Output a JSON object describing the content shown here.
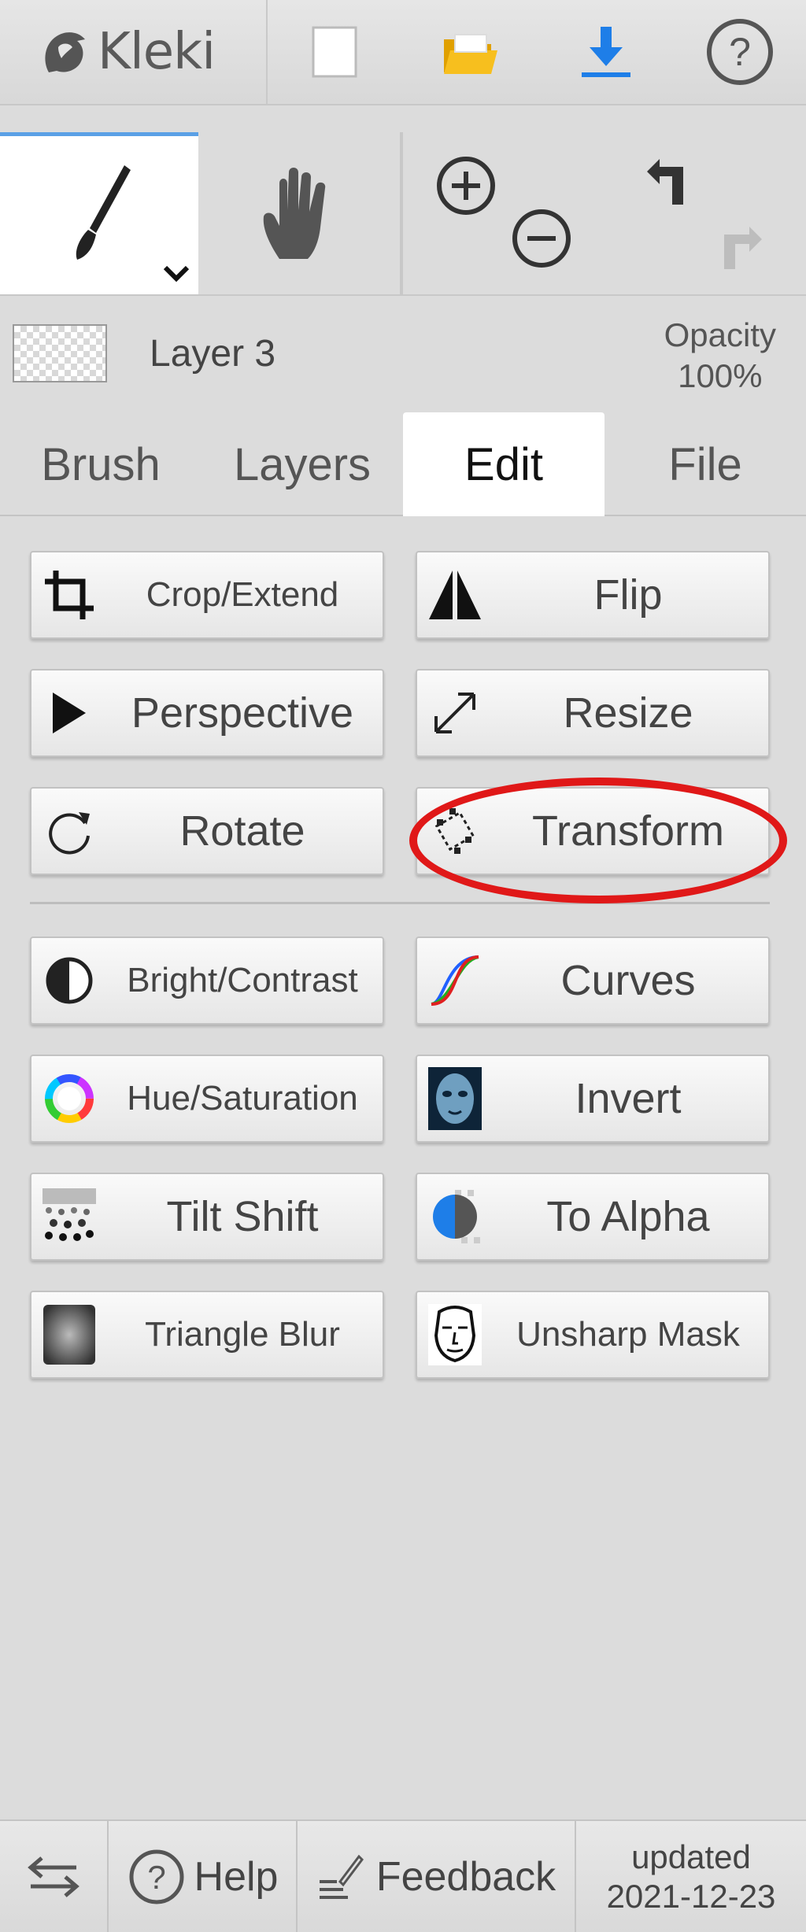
{
  "app": {
    "name": "Kleki"
  },
  "topbar": {
    "icons": [
      "kleki-logo-icon",
      "new-file-icon",
      "open-folder-icon",
      "download-icon",
      "help-icon"
    ]
  },
  "layer": {
    "name": "Layer 3",
    "opacity_label": "Opacity",
    "opacity_value": "100%"
  },
  "tabs": [
    {
      "label": "Brush",
      "active": false
    },
    {
      "label": "Layers",
      "active": false
    },
    {
      "label": "Edit",
      "active": true
    },
    {
      "label": "File",
      "active": false
    }
  ],
  "edit": {
    "buttons": [
      {
        "label": "Crop/Extend",
        "icon": "crop-icon"
      },
      {
        "label": "Flip",
        "icon": "flip-icon"
      },
      {
        "label": "Perspective",
        "icon": "perspective-icon"
      },
      {
        "label": "Resize",
        "icon": "resize-icon"
      },
      {
        "label": "Rotate",
        "icon": "rotate-icon"
      },
      {
        "label": "Transform",
        "icon": "transform-icon"
      },
      {
        "label": "Bright/Contrast",
        "icon": "brightness-contrast-icon"
      },
      {
        "label": "Curves",
        "icon": "curves-icon"
      },
      {
        "label": "Hue/Saturation",
        "icon": "hue-saturation-icon"
      },
      {
        "label": "Invert",
        "icon": "invert-icon"
      },
      {
        "label": "Tilt Shift",
        "icon": "tilt-shift-icon"
      },
      {
        "label": "To Alpha",
        "icon": "to-alpha-icon"
      },
      {
        "label": "Triangle Blur",
        "icon": "triangle-blur-icon"
      },
      {
        "label": "Unsharp Mask",
        "icon": "unsharp-mask-icon"
      }
    ]
  },
  "bottombar": {
    "help": "Help",
    "feedback": "Feedback",
    "updated_label": "updated",
    "updated_date": "2021-12-23"
  },
  "colors": {
    "active_tab_accent": "#5aa0e6",
    "highlight": "#e01818",
    "download": "#1e7ee8",
    "folder": "#f5b800"
  }
}
